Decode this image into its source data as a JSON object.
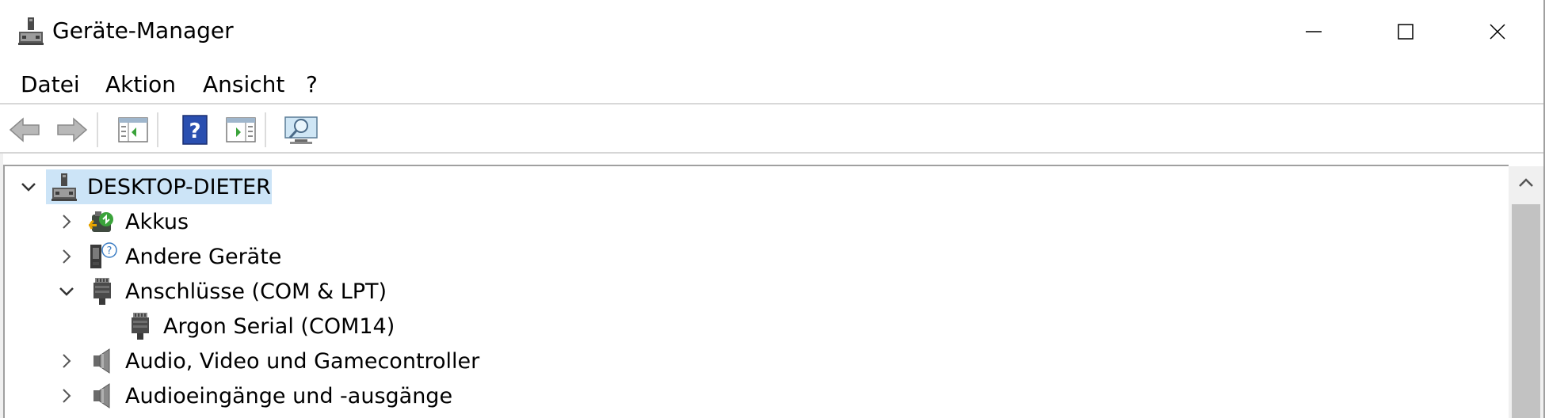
{
  "window": {
    "title": "Geräte-Manager",
    "icon": "device-manager-icon"
  },
  "menu": {
    "items": [
      "Datei",
      "Aktion",
      "Ansicht",
      "?"
    ]
  },
  "toolbar": {
    "buttons": [
      {
        "name": "back-arrow-icon"
      },
      {
        "name": "forward-arrow-icon"
      },
      {
        "name": "show-hide-console-tree-icon"
      },
      {
        "name": "help-icon"
      },
      {
        "name": "show-action-pane-icon"
      },
      {
        "name": "scan-hardware-icon"
      }
    ]
  },
  "tree": {
    "root": {
      "label": "DESKTOP-DIETER",
      "expanded": true,
      "selected": true
    },
    "items": [
      {
        "label": "Akkus",
        "expanded": false,
        "icon": "battery-icon"
      },
      {
        "label": "Andere Geräte",
        "expanded": false,
        "icon": "unknown-device-icon"
      },
      {
        "label": "Anschlüsse (COM & LPT)",
        "expanded": true,
        "icon": "port-icon"
      },
      {
        "label": "Argon Serial (COM14)",
        "child": true,
        "icon": "port-icon"
      },
      {
        "label": "Audio, Video und Gamecontroller",
        "expanded": false,
        "icon": "speaker-icon"
      },
      {
        "label": "Audioeingänge und -ausgänge",
        "expanded": false,
        "icon": "speaker-icon"
      }
    ]
  },
  "colors": {
    "selection": "#cce4f7",
    "help_blue": "#2a4fb0",
    "border": "#a0a0a0"
  }
}
